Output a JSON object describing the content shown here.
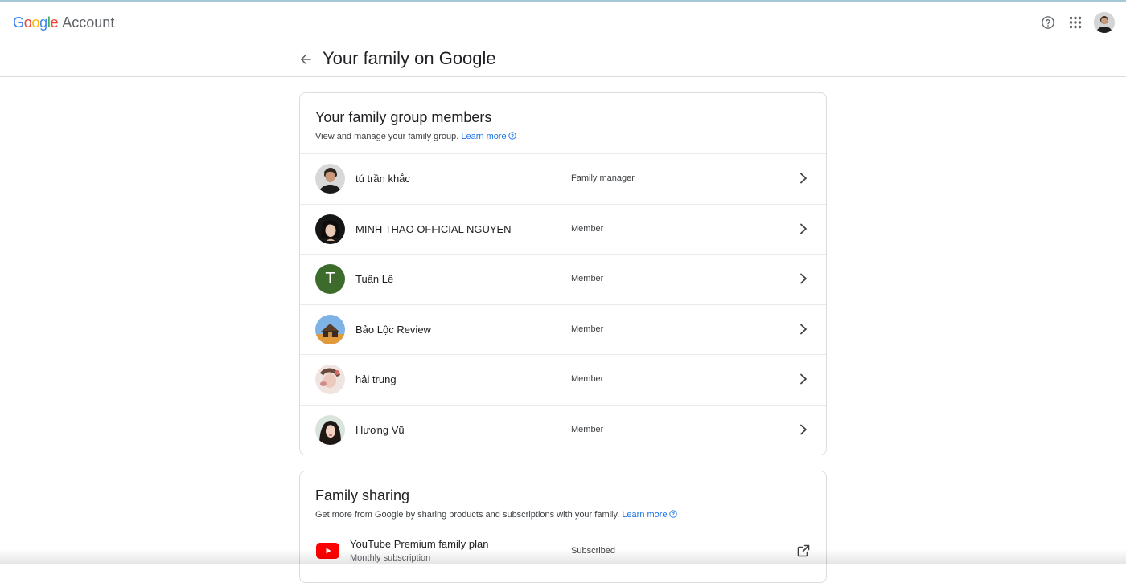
{
  "brand": {
    "google_letters": [
      "G",
      "o",
      "o",
      "g",
      "l",
      "e"
    ],
    "google_colors": [
      "#4285F4",
      "#EA4335",
      "#FBBC05",
      "#4285F4",
      "#34A853",
      "#EA4335"
    ],
    "product": "Account"
  },
  "header_icons": [
    "help-icon",
    "apps-grid-icon",
    "account-avatar"
  ],
  "subheader": {
    "title": "Your family on Google"
  },
  "members_card": {
    "title": "Your family group members",
    "description": "View and manage your family group.",
    "learn_more": "Learn more",
    "members": [
      {
        "name": "tú trần khắc",
        "role": "Family manager",
        "avatar": "photo"
      },
      {
        "name": "MINH THAO OFFICIAL NGUYEN",
        "role": "Member",
        "avatar": "photo"
      },
      {
        "name": "Tuấn Lê",
        "role": "Member",
        "avatar": "letter",
        "letter": "T"
      },
      {
        "name": "Bảo Lộc Review",
        "role": "Member",
        "avatar": "photo"
      },
      {
        "name": "hải trung",
        "role": "Member",
        "avatar": "photo"
      },
      {
        "name": "Hương Vũ",
        "role": "Member",
        "avatar": "photo"
      }
    ]
  },
  "sharing_card": {
    "title": "Family sharing",
    "description": "Get more from Google by sharing products and subscriptions with your family.",
    "learn_more": "Learn more",
    "services": [
      {
        "name": "YouTube Premium family plan",
        "subtitle": "Monthly subscription",
        "status": "Subscribed",
        "icon": "youtube-icon"
      }
    ]
  },
  "colors": {
    "link": "#1a73e8",
    "divider": "#dadce0",
    "letter_avatar_bg": "#3d6b2b",
    "youtube_red": "#ff0000"
  }
}
